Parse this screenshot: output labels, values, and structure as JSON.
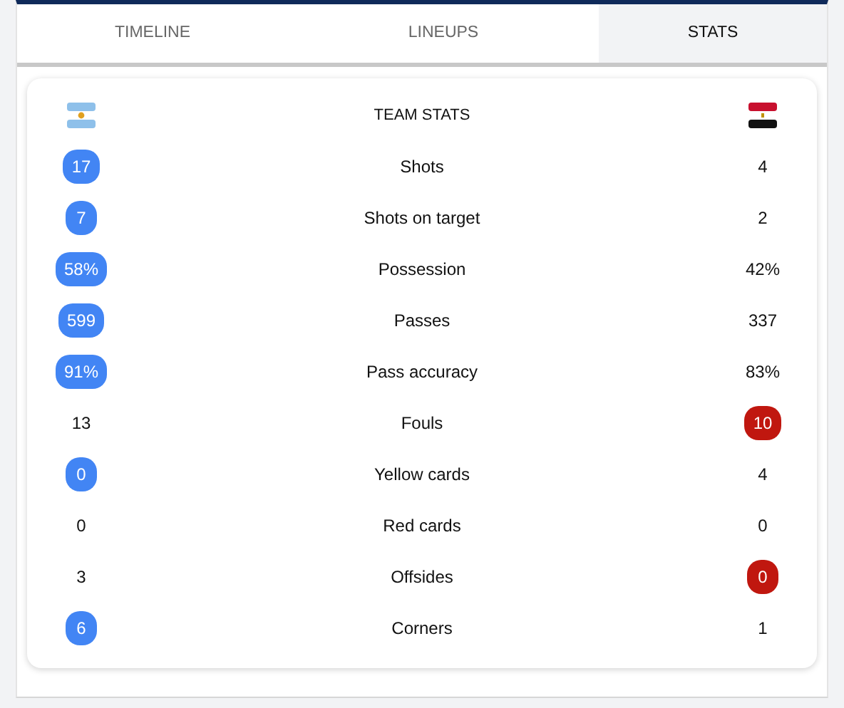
{
  "tabs": [
    {
      "label": "TIMELINE",
      "selected": false
    },
    {
      "label": "LINEUPS",
      "selected": false
    },
    {
      "label": "STATS",
      "selected": true
    }
  ],
  "team_stats": {
    "title": "TEAM STATS",
    "rows": [
      {
        "label": "Shots",
        "home": {
          "value": "17",
          "highlighted": true
        },
        "away": {
          "value": "4",
          "highlighted": false
        }
      },
      {
        "label": "Shots on target",
        "home": {
          "value": "7",
          "highlighted": true
        },
        "away": {
          "value": "2",
          "highlighted": false
        }
      },
      {
        "label": "Possession",
        "home": {
          "value": "58%",
          "highlighted": true
        },
        "away": {
          "value": "42%",
          "highlighted": false
        }
      },
      {
        "label": "Passes",
        "home": {
          "value": "599",
          "highlighted": true
        },
        "away": {
          "value": "337",
          "highlighted": false
        }
      },
      {
        "label": "Pass accuracy",
        "home": {
          "value": "91%",
          "highlighted": true
        },
        "away": {
          "value": "83%",
          "highlighted": false
        }
      },
      {
        "label": "Fouls",
        "home": {
          "value": "13",
          "highlighted": false
        },
        "away": {
          "value": "10",
          "highlighted": true
        }
      },
      {
        "label": "Yellow cards",
        "home": {
          "value": "0",
          "highlighted": true
        },
        "away": {
          "value": "4",
          "highlighted": false
        }
      },
      {
        "label": "Red cards",
        "home": {
          "value": "0",
          "highlighted": false
        },
        "away": {
          "value": "0",
          "highlighted": false
        }
      },
      {
        "label": "Offsides",
        "home": {
          "value": "3",
          "highlighted": false
        },
        "away": {
          "value": "0",
          "highlighted": true
        }
      },
      {
        "label": "Corners",
        "home": {
          "value": "6",
          "highlighted": true
        },
        "away": {
          "value": "1",
          "highlighted": false
        }
      }
    ]
  }
}
